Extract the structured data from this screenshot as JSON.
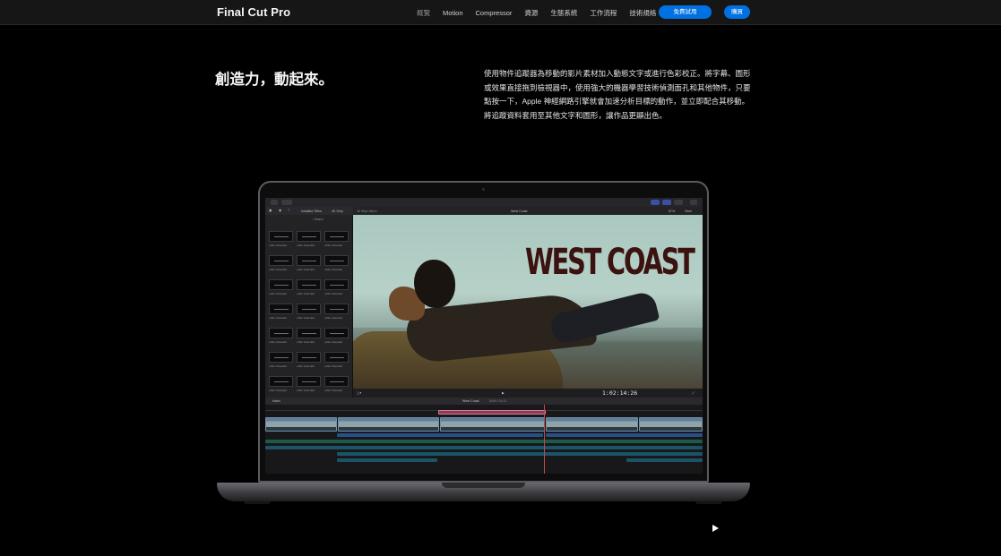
{
  "nav": {
    "brand": "Final Cut Pro",
    "links": [
      "概覽",
      "Motion",
      "Compressor",
      "資源",
      "生態系統",
      "工作流程",
      "技術規格"
    ],
    "trial_button": "免費試用",
    "buy_button": "購買"
  },
  "hero": {
    "headline": "創造力，動起來。",
    "description": "使用物件追蹤器為移動的影片素材加入動態文字或進行色彩校正。將字幕、圖形或效果直接拖到檢視器中，使用強大的機器學習技術偵測面孔和其他物件，只要點按一下，Apple 神經網路引擎就會加速分析目標的動作，並立即配合其移動。將追蹤資料套用至其他文字和圖形，讓作品更顯出色。"
  },
  "app": {
    "browser": {
      "heading": "Installed Titles",
      "filter": "4K Only",
      "search_placeholder": "Search",
      "thumb_label": "+Film Cinematic"
    },
    "viewer": {
      "format": "4K 30fps Stereo",
      "clip_name": "West Coast",
      "zoom": "87%",
      "view_menu": "View",
      "overlay_title": "WEST COAST",
      "timecode": "1:02:14:26"
    },
    "timeline": {
      "index_label": "Index",
      "project_name": "West Coast",
      "duration": "00:00 / 01:13"
    }
  },
  "colors": {
    "accent": "#0071e3",
    "overlay_title": "#3b120f",
    "playhead": "#c14b4b"
  },
  "icons": {
    "play": "play-icon"
  }
}
